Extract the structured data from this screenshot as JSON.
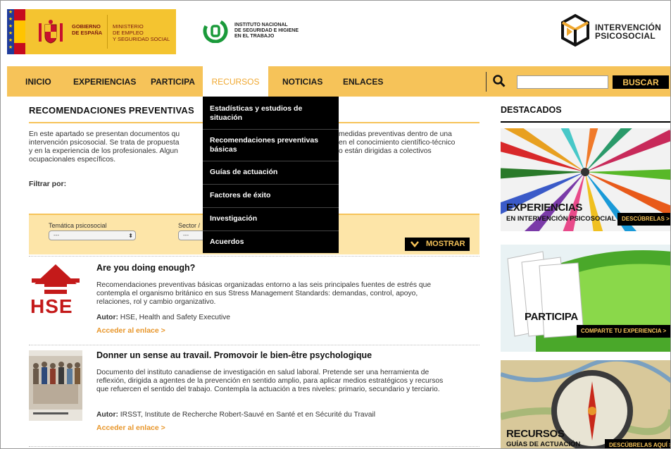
{
  "header": {
    "gov_line1": "GOBIERNO",
    "gov_line2": "DE ESPAÑA",
    "ministry_line1": "MINISTERIO",
    "ministry_line2": "DE EMPLEO",
    "ministry_line3": "Y SEGURIDAD SOCIAL",
    "insht_line1": "INSTITUTO NACIONAL",
    "insht_line2": "DE SEGURIDAD E HIGIENE",
    "insht_line3": "EN EL TRABAJO",
    "site_line1": "INTERVENCIÓN",
    "site_line2": "PSICOSOCIAL"
  },
  "nav": {
    "items": [
      {
        "label": "INICIO"
      },
      {
        "label": "EXPERIENCIAS"
      },
      {
        "label": "PARTICIPA"
      },
      {
        "label": "RECURSOS"
      },
      {
        "label": "NOTICIAS"
      },
      {
        "label": "ENLACES"
      }
    ],
    "search_placeholder": "",
    "search_button": "BUSCAR"
  },
  "dropdown": {
    "items": [
      {
        "label": "Estadísticas y estudios de situación"
      },
      {
        "label": "Recomendaciones preventivas básicas"
      },
      {
        "label": "Guías de actuación"
      },
      {
        "label": "Factores de éxito"
      },
      {
        "label": "Investigación"
      },
      {
        "label": "Acuerdos"
      }
    ]
  },
  "main": {
    "title": "RECOMENDACIONES PREVENTIVAS",
    "intro_line1": "En este apartado se presentan documentos qu",
    "intro_line1_end": "medidas preventivas dentro de una",
    "intro_line2": "intervención psicosocial. Se trata de propuesta",
    "intro_line2_end": "en el conocimiento científico-técnico",
    "intro_line3": "y en la experiencia de los profesionales. Algun",
    "intro_line3_end": "o están dirigidas a colectivos",
    "intro_line4": "ocupacionales específicos.",
    "filter_label": "Filtrar por:",
    "filter_tematica_label": "Temática psicosocial",
    "filter_tematica_value": "---",
    "filter_sector_label": "Sector /",
    "filter_sector_value": "---",
    "show_button": "MOSTRAR",
    "items": [
      {
        "title": "Are you doing enough?",
        "desc": "Recomendaciones preventivas básicas organizadas entorno a las seis principales fuentes de estrés que contempla el organismo británico en sus Stress Management Standards: demandas, control, apoyo, relaciones, rol y cambio organizativo.",
        "author_label": "Autor:",
        "author": "HSE, Health and Safety Executive",
        "link": "Acceder al enlace >",
        "thumb_text": "HSE"
      },
      {
        "title": "Donner un sense au travail. Promovoir le bien-être psychologique",
        "desc": "Documento del instituto canadiense de investigación en salud laboral. Pretende ser una herramienta de reflexión, dirigida a agentes de la prevención en sentido amplio, para aplicar medios estratégicos y recursos que refuercen el sentido del trabajo. Contempla la actuación a tres niveles: primario, secundario y terciario.",
        "author_label": "Autor:",
        "author": "IRSST, Institute de Recherche Robert-Sauvé en Santé et en Sécurité du Travail",
        "link": "Acceder al enlace >"
      }
    ]
  },
  "sidebar": {
    "title": "DESTACADOS",
    "tiles": [
      {
        "title": "EXPERIENCIAS",
        "subtitle": "EN INTERVENCIÓN PSICOSOCIAL",
        "button": "DESCÚBRELAS >"
      },
      {
        "title": "PARTICIPA",
        "subtitle": "",
        "button": "COMPARTE TU EXPERIENCIA >"
      },
      {
        "title": "RECURSOS",
        "subtitle": "GUÍAS DE ACTUACIÓN",
        "button": "DESCÚBRELAS AQUÍ >"
      }
    ]
  },
  "colors": {
    "accent": "#f6c359",
    "link": "#e8962a",
    "dark": "#000000"
  }
}
